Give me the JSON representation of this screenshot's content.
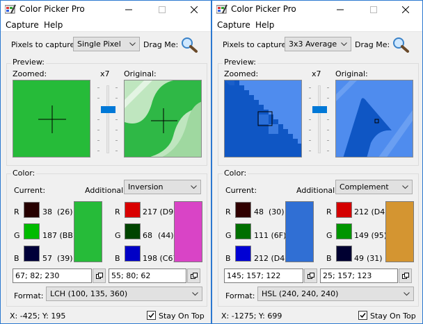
{
  "windows": [
    {
      "title": "Color Picker Pro",
      "menu": [
        "Capture",
        "Help"
      ],
      "pixels_label": "Pixels to capture:",
      "pixels_value": "Single Pixel",
      "drag_label": "Drag Me:",
      "preview_label": "Preview:",
      "zoomed_label": "Zoomed:",
      "original_label": "Original:",
      "zoom_factor": "x7",
      "color_label": "Color:",
      "current_label": "Current:",
      "additional_label": "Additional:",
      "additional_value": "Inversion",
      "current": {
        "r": {
          "letter": "R",
          "value": "38",
          "hex": "(26)",
          "color": "#260000"
        },
        "g": {
          "letter": "G",
          "value": "187 (BB)",
          "color": "#00bb00"
        },
        "b": {
          "letter": "B",
          "value": "57",
          "hex": "(39)",
          "color": "#000039"
        },
        "color": "#26bb39"
      },
      "additional": {
        "r": {
          "letter": "R",
          "value": "217 (D9)",
          "color": "#d90000"
        },
        "g": {
          "letter": "G",
          "value": "68",
          "hex": "(44)",
          "color": "#004400"
        },
        "b": {
          "letter": "B",
          "value": "198 (C6)",
          "color": "#0000c6"
        },
        "color": "#d944c6"
      },
      "current_text": "67; 82; 230",
      "additional_text": "55; 80; 62",
      "format_label": "Format:",
      "format_value": "LCH (100, 135, 360)",
      "coords": "X: -425; Y: 195",
      "stay_on_top": "Stay On Top"
    },
    {
      "title": "Color Picker Pro",
      "menu": [
        "Capture",
        "Help"
      ],
      "pixels_label": "Pixels to capture:",
      "pixels_value": "3x3 Average",
      "drag_label": "Drag Me:",
      "preview_label": "Preview:",
      "zoomed_label": "Zoomed:",
      "original_label": "Original:",
      "zoom_factor": "x7",
      "color_label": "Color:",
      "current_label": "Current:",
      "additional_label": "Additional:",
      "additional_value": "Complement",
      "current": {
        "r": {
          "letter": "R",
          "value": "48",
          "hex": "(30)",
          "color": "#300000"
        },
        "g": {
          "letter": "G",
          "value": "111 (6F)",
          "color": "#006f00"
        },
        "b": {
          "letter": "B",
          "value": "212 (D4)",
          "color": "#0000d4"
        },
        "color": "#306fd4"
      },
      "additional": {
        "r": {
          "letter": "R",
          "value": "212 (D4)",
          "color": "#d40000"
        },
        "g": {
          "letter": "G",
          "value": "149 (95)",
          "color": "#009500"
        },
        "b": {
          "letter": "B",
          "value": "49",
          "hex": "(31)",
          "color": "#000031"
        },
        "color": "#d49531"
      },
      "current_text": "145; 157; 122",
      "additional_text": "25; 157; 123",
      "format_label": "Format:",
      "format_value": "HSL (240, 240, 240)",
      "coords": "X: -1275; Y: 699",
      "stay_on_top": "Stay On Top"
    }
  ]
}
